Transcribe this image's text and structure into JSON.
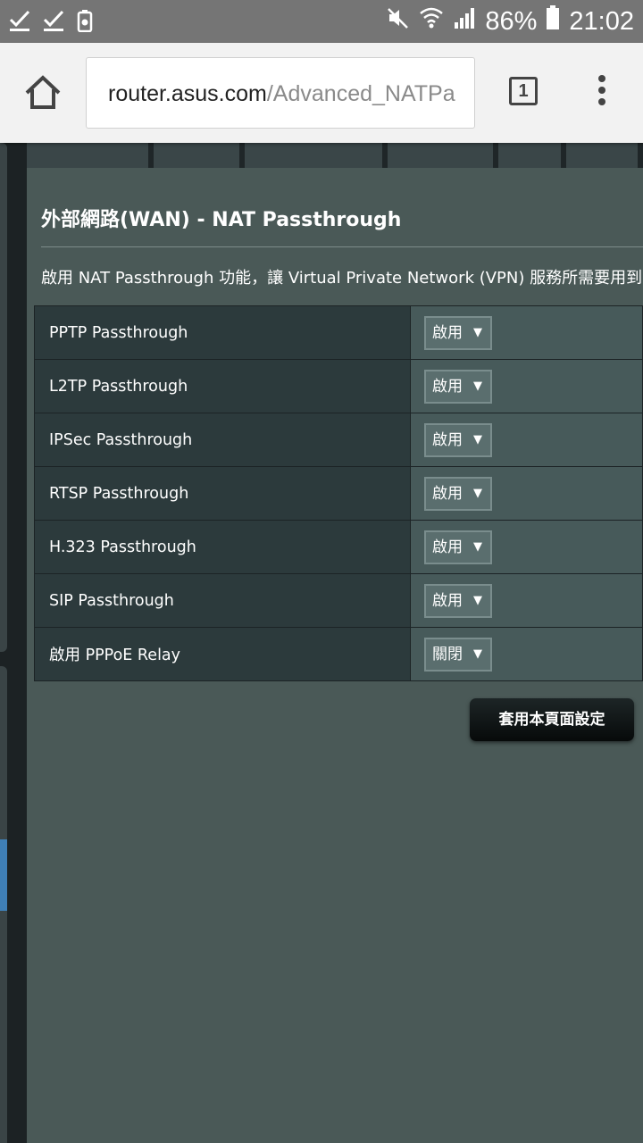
{
  "status_bar": {
    "battery": "86%",
    "time": "21:02"
  },
  "browser": {
    "url_host": "router.asus.com",
    "url_path": "/Advanced_NATPa",
    "tab_count": "1"
  },
  "page": {
    "title": "外部網路(WAN) - NAT Passthrough",
    "description": "啟用 NAT Passthrough 功能，讓 Virtual Private Network (VPN) 服務所需要用到",
    "apply_label": "套用本頁面設定"
  },
  "settings": [
    {
      "label": "PPTP Passthrough",
      "value": "啟用"
    },
    {
      "label": "L2TP Passthrough",
      "value": "啟用"
    },
    {
      "label": "IPSec Passthrough",
      "value": "啟用"
    },
    {
      "label": "RTSP Passthrough",
      "value": "啟用"
    },
    {
      "label": "H.323 Passthrough",
      "value": "啟用"
    },
    {
      "label": "SIP Passthrough",
      "value": "啟用"
    },
    {
      "label": "啟用 PPPoE Relay",
      "value": "關閉"
    }
  ],
  "icons": [
    "check-icon",
    "check-icon",
    "battery-saver-icon",
    "mute-icon",
    "wifi-icon",
    "signal-icon",
    "battery-icon",
    "home-icon",
    "tabs-icon",
    "more-vert-icon",
    "dropdown-arrow-icon"
  ]
}
